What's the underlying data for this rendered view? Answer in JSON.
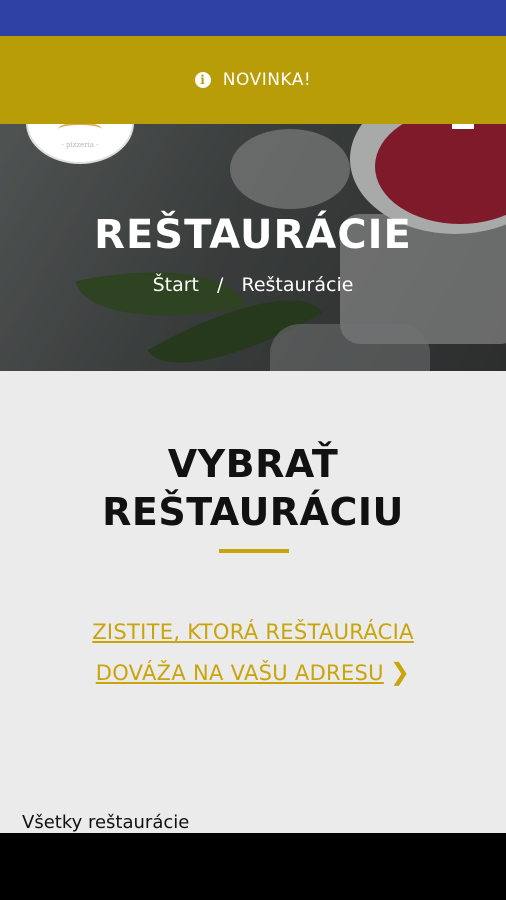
{
  "banner": {
    "text": "NOVINKA!",
    "icon": "info-icon",
    "color": "#b89c08"
  },
  "logo": {
    "text": "- pizzeria -"
  },
  "hero": {
    "title": "REŠTAURÁCIE",
    "breadcrumb": {
      "home": "Štart",
      "separator": "/",
      "current": "Reštaurácie"
    }
  },
  "section": {
    "title_line1": "VYBRAŤ",
    "title_line2": "REŠTAURÁCIU",
    "cta_line1": "ZISTITE, KTORÁ REŠTAURÁCIA",
    "cta_line2": "DOVÁŽA NA VAŠU ADRESU",
    "cta_icon": "chevron-right-icon",
    "accent": "#c9a40a"
  },
  "list": {
    "heading": "Všetky reštaurácie"
  },
  "colors": {
    "status_bar": "#2f41a3",
    "background": "#ebebeb"
  }
}
